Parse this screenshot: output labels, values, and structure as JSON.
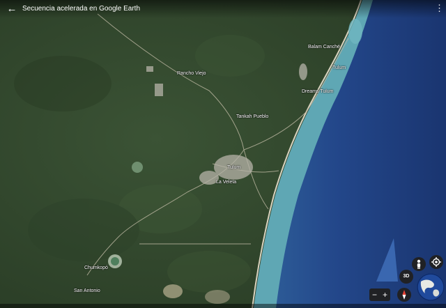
{
  "header": {
    "title": "Secuencia acelerada en Google Earth",
    "back_glyph": "←",
    "menu_glyph": "⋮",
    "back_icon": "back-arrow-icon",
    "menu_icon": "more-vert-icon"
  },
  "places": [
    {
      "id": "balam-canche",
      "label": "Balam Canché"
    },
    {
      "id": "tulum-ruins",
      "label": "Tulum"
    },
    {
      "id": "rancho-viejo",
      "label": "Rancho Viejo"
    },
    {
      "id": "dreams-tulum",
      "label": "Dreams Tulum"
    },
    {
      "id": "tankah-pueblo",
      "label": "Tankah Pueblo"
    },
    {
      "id": "tulum-town",
      "label": "Tulum"
    },
    {
      "id": "la-veleta",
      "label": "La Veleta"
    },
    {
      "id": "chumkopo",
      "label": "Chumkopó"
    },
    {
      "id": "san-antonio",
      "label": "San Antonio"
    }
  ],
  "controls": {
    "three_d_label": "3D",
    "zoom_out_label": "−",
    "zoom_in_label": "+",
    "street_view_icon": "pegman-icon",
    "location_icon": "my-location-icon",
    "compass_icon": "compass-icon",
    "globe_icon": "globe-icon"
  },
  "colors": {
    "land": "#34492f",
    "sea_shallow": "#5fa7b4",
    "sea_deep": "#1f3f7a",
    "beach": "#d9d3c0",
    "label": "#ffffff",
    "control_bg": "#202124"
  }
}
